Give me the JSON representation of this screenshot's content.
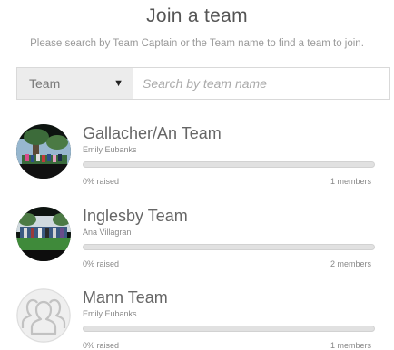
{
  "header": {
    "title": "Join a team",
    "subtitle": "Please search by Team Captain or the Team name to find a team to join."
  },
  "search": {
    "type_value": "Team",
    "placeholder": "Search by team name",
    "value": ""
  },
  "teams": [
    {
      "name": "Gallacher/An Team",
      "captain": "Emily Eubanks",
      "raised_label": "0% raised",
      "raised_fraction": 0,
      "members_label": "1 members",
      "avatar": "photo-outdoor-group"
    },
    {
      "name": "Inglesby Team",
      "captain": "Ana Villagran",
      "raised_label": "0% raised",
      "raised_fraction": 0,
      "members_label": "2 members",
      "avatar": "photo-group-on-lawn"
    },
    {
      "name": "Mann Team",
      "captain": "Emily Eubanks",
      "raised_label": "0% raised",
      "raised_fraction": 0,
      "members_label": "1 members",
      "avatar": "group-placeholder-icon"
    }
  ],
  "colors": {
    "progress_fill": "#9ccd5a",
    "progress_track": "#e1e1e1"
  }
}
